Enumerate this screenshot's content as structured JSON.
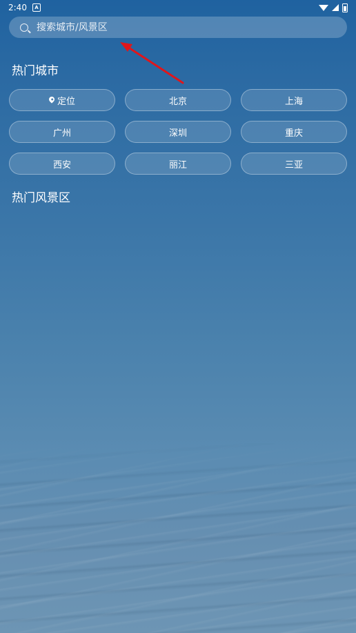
{
  "status_bar": {
    "time": "2:40",
    "app_icon_letter": "A"
  },
  "search": {
    "placeholder": "搜索城市/风景区",
    "value": ""
  },
  "hot_cities": {
    "title": "热门城市",
    "locate_label": "定位",
    "cities": [
      "北京",
      "上海",
      "广州",
      "深圳",
      "重庆",
      "西安",
      "丽江",
      "三亚"
    ]
  },
  "hot_scenic": {
    "title": "热门风景区"
  },
  "annotation": {
    "arrow_color": "#e0161b"
  }
}
